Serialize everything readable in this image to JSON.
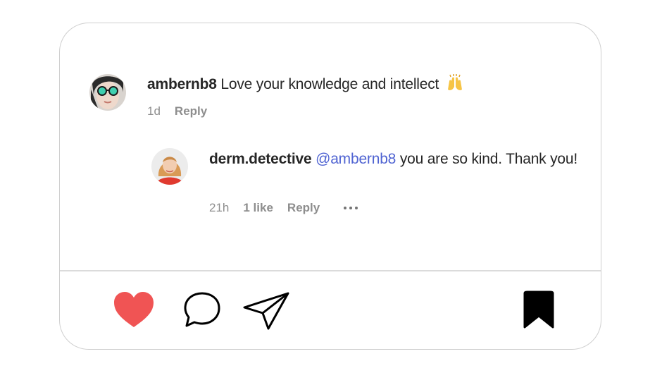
{
  "comments": [
    {
      "username": "ambernb8",
      "text": "Love your knowledge and intellect",
      "emoji": "raised-hands-emoji",
      "time": "1d",
      "reply_label": "Reply"
    }
  ],
  "reply": {
    "username": "derm.detective",
    "mention": "@ambernb8",
    "text": "you are so kind. Thank you!",
    "time": "21h",
    "likes": "1 like",
    "reply_label": "Reply"
  },
  "actions": {
    "like_icon": "heart-icon",
    "comment_icon": "comment-bubble-icon",
    "share_icon": "paper-plane-icon",
    "save_icon": "bookmark-icon"
  },
  "colors": {
    "heart": "#f05454",
    "mention": "#4f63d2",
    "text": "#262626",
    "meta": "#8e8e8e",
    "bookmark": "#000000"
  }
}
